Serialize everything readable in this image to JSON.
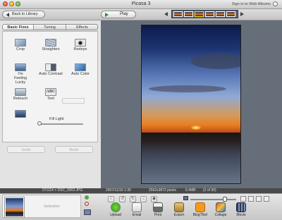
{
  "window": {
    "title": "Picasa 3",
    "sign_in": "Sign in to Web Albums"
  },
  "toolbar": {
    "back_label": "Back to Library",
    "play_label": "Play",
    "filmstrip_count": 5,
    "filmstrip_selected_index": 2
  },
  "panel": {
    "tabs": [
      {
        "label": "Basic Fixes",
        "active": true
      },
      {
        "label": "Tuning",
        "active": false
      },
      {
        "label": "Effects",
        "active": false
      }
    ],
    "tools": [
      {
        "label": "Crop",
        "icon": "crop-icon"
      },
      {
        "label": "Straighten",
        "icon": "straighten-icon"
      },
      {
        "label": "Redeye",
        "icon": "redeye-icon"
      },
      {
        "label": "I'm Feeling Lucky",
        "icon": "lucky-icon"
      },
      {
        "label": "Auto Contrast",
        "icon": "auto-contrast-icon"
      },
      {
        "label": "Auto Color",
        "icon": "auto-color-icon"
      },
      {
        "label": "Retouch",
        "icon": "retouch-icon"
      },
      {
        "label": "Text",
        "icon": "text-icon",
        "icon_text": "ABC"
      }
    ],
    "fill_light": {
      "label": "Fill Light",
      "value": 0
    },
    "undo_label": "Undo",
    "redo_label": "Redo"
  },
  "info": {
    "folder_file": "071114 > DSC_0002.JPG",
    "datetime": "2007/11/16 1:35",
    "dimensions": "2592x3872 pixels",
    "size": "6.4MB",
    "position": "(2 of 30)"
  },
  "tray": {
    "selection_label": "Selection",
    "actions": [
      {
        "label": "Upload",
        "icon": "upload-icon"
      },
      {
        "label": "Email",
        "icon": "email-icon"
      },
      {
        "label": "Print",
        "icon": "print-icon"
      },
      {
        "label": "Export",
        "icon": "export-icon"
      },
      {
        "label": "BlogThis!",
        "icon": "blogger-icon"
      },
      {
        "label": "Collage",
        "icon": "collage-icon"
      },
      {
        "label": "Movie",
        "icon": "movie-icon"
      }
    ],
    "zoom_level": 0.7
  }
}
